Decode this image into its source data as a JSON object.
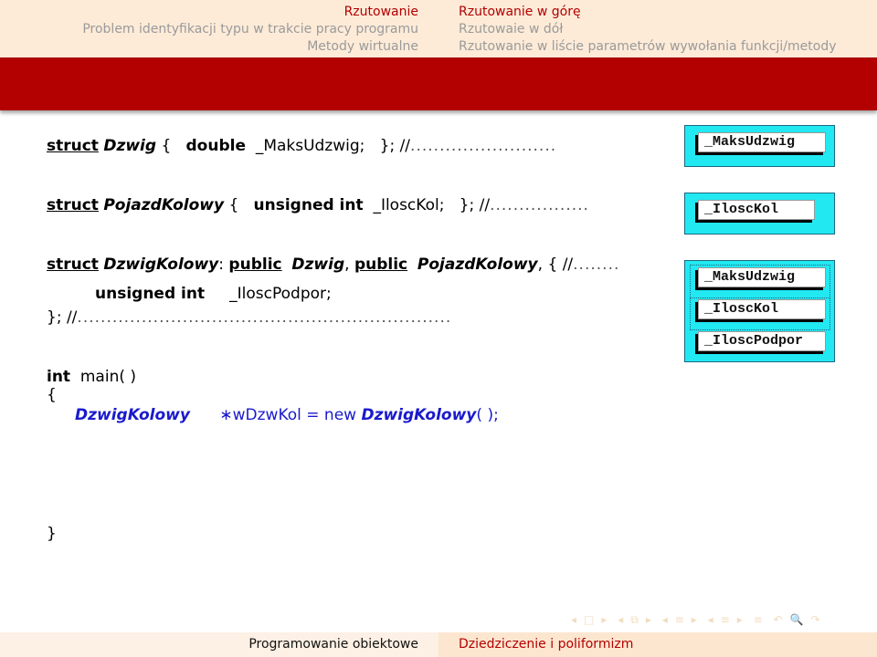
{
  "header": {
    "left": [
      {
        "label": "Rzutowanie",
        "active": true
      },
      {
        "label": "Problem identyfikacji typu w trakcie pracy programu",
        "active": false
      },
      {
        "label": "Metody wirtualne",
        "active": false
      }
    ],
    "right": [
      {
        "label": "Rzutowanie w górę",
        "active": true
      },
      {
        "label": "Rzutowaie w dół",
        "active": false
      },
      {
        "label": "Rzutowanie w liście parametrów wywołania funkcji/metody",
        "active": false
      }
    ]
  },
  "code": {
    "line1": {
      "kw_struct": "struct",
      "class_name": "Dzwig",
      "open_brace": "{",
      "type": "double",
      "member": "_MaksUdzwig;",
      "close": "};",
      "comment": "//",
      "dots": "........................."
    },
    "line2": {
      "kw_struct": "struct",
      "class_name": "PojazdKolowy",
      "open_brace": "{",
      "type": "unsigned int",
      "member": "_IloscKol;",
      "close": "};",
      "comment": "//",
      "dots": "................."
    },
    "line3": {
      "kw_struct": "struct",
      "class_name": "DzwigKolowy",
      "colon": ":",
      "public1": "public",
      "base1": "Dzwig",
      "comma1": ",",
      "public2": "public",
      "base2": "PojazdKolowy",
      "comma2": ",",
      "open_brace": "{",
      "comment": "//",
      "dots": "........"
    },
    "line4": {
      "type": "unsigned int",
      "member": "_IloscPodpor;"
    },
    "line5": {
      "close": "};",
      "comment": "//",
      "dots": "................................................................"
    },
    "main": {
      "ret_type": "int",
      "signature": "main( )",
      "open_brace": "{",
      "decl_type": "DzwigKolowy",
      "decl_var": "∗wDzwKol = new",
      "ctor": "DzwigKolowy",
      "ctor_tail": "( );",
      "close_brace": "}"
    }
  },
  "diagrams": {
    "dzwig": [
      "_MaksUdzwig"
    ],
    "pojazd": [
      "_IloscKol"
    ],
    "dzwig_kolowy": [
      "_MaksUdzwig",
      "_IloscKol",
      "_IloscPodpor"
    ],
    "box_color": "#22e8f2"
  },
  "nav_icons": [
    "◂",
    "□",
    "▸",
    "◂",
    "⧉",
    "▸",
    "◂",
    "≡",
    "▸",
    "◂",
    "≡",
    "▸",
    "≡",
    "↶",
    "🔍",
    "↷"
  ],
  "footer": {
    "left": "Programowanie obiektowe",
    "right": "Dziedziczenie i poliformizm"
  },
  "colors": {
    "accent_red": "#b30000",
    "header_bg": "#fdebd8",
    "code_blue": "#1a1acc"
  }
}
